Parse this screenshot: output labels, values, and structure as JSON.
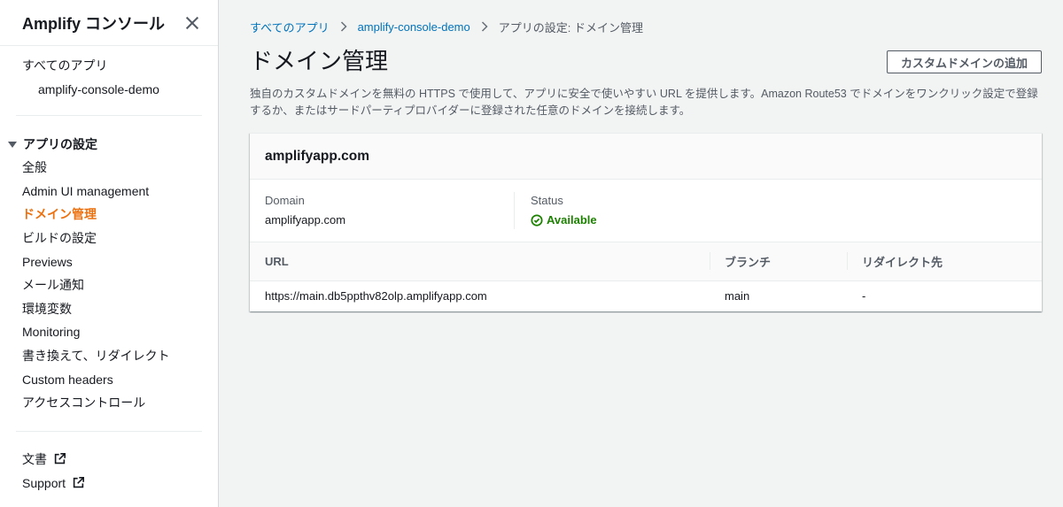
{
  "sidebar": {
    "title": "Amplify コンソール",
    "all_apps": "すべてのアプリ",
    "app_name": "amplify-console-demo",
    "group_title": "アプリの設定",
    "items": [
      "全般",
      "Admin UI management",
      "ドメイン管理",
      "ビルドの設定",
      "Previews",
      "メール通知",
      "環境変数",
      "Monitoring",
      "書き換えて、リダイレクト",
      "Custom headers",
      "アクセスコントロール"
    ],
    "active_item": "ドメイン管理",
    "footer": [
      "文書",
      "Support"
    ]
  },
  "breadcrumb": {
    "items": [
      "すべてのアプリ",
      "amplify-console-demo",
      "アプリの設定: ドメイン管理"
    ]
  },
  "page": {
    "title": "ドメイン管理",
    "add_button": "カスタムドメインの追加",
    "description": "独自のカスタムドメインを無料の HTTPS で使用して、アプリに安全で使いやすい URL を提供します。Amazon Route53 でドメインをワンクリック設定で登録するか、またはサードパーティプロバイダーに登録された任意のドメインを接続します。"
  },
  "domain_card": {
    "title": "amplifyapp.com",
    "domain_label": "Domain",
    "domain_value": "amplifyapp.com",
    "status_label": "Status",
    "status_value": "Available",
    "table": {
      "headers": [
        "URL",
        "ブランチ",
        "リダイレクト先"
      ],
      "rows": [
        [
          "https://main.db5ppthv82olp.amplifyapp.com",
          "main",
          "-"
        ]
      ]
    }
  },
  "colors": {
    "link": "#0073bb",
    "active": "#ec7211",
    "success": "#1d8102",
    "background": "#f2f3f3"
  }
}
